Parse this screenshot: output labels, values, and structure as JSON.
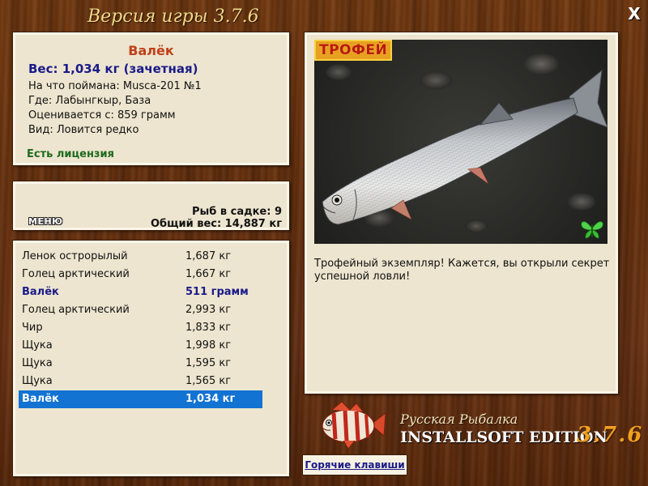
{
  "window": {
    "version_title": "Версия игры 3.7.6",
    "close_label": "X"
  },
  "fish_info": {
    "name": "Валёк",
    "weight": "Вес: 1,034 кг (зачетная)",
    "lines": [
      "На что поймана: Musca-201 №1",
      "Где: Лабынгкыр, База",
      "Оценивается с: 859 грамм",
      "Вид: Ловится редко"
    ],
    "license": "Есть лицензия"
  },
  "keepnet": {
    "menu_label": "МЕНЮ",
    "fish_count": "Рыб в садке: 9",
    "total_weight": "Общий вес: 14,887 кг"
  },
  "catch_list": [
    {
      "name": "Ленок острорылый",
      "weight": "1,687 кг",
      "style": "normal"
    },
    {
      "name": "Голец арктический",
      "weight": "1,667 кг",
      "style": "normal"
    },
    {
      "name": "Валёк",
      "weight": "511 грамм",
      "style": "trophy"
    },
    {
      "name": "Голец арктический",
      "weight": "2,993 кг",
      "style": "normal"
    },
    {
      "name": "Чир",
      "weight": "1,833 кг",
      "style": "normal"
    },
    {
      "name": "Щука",
      "weight": "1,998 кг",
      "style": "normal"
    },
    {
      "name": "Щука",
      "weight": "1,595 кг",
      "style": "normal"
    },
    {
      "name": "Щука",
      "weight": "1,565 кг",
      "style": "normal"
    },
    {
      "name": "Валёк",
      "weight": "1,034 кг",
      "style": "selected"
    }
  ],
  "photo": {
    "trophy_label": "ТРОФЕЙ",
    "butterfly_icon": "butterfly-icon",
    "description": "Трофейный экземпляр! Кажется, вы открыли секрет успешной ловли!"
  },
  "logo": {
    "subtitle": "Русская Рыбалка",
    "edition": "INSTALLSOFT EDITION",
    "version": "3.7.6"
  },
  "hotkeys_label": "Горячие клавиши",
  "colors": {
    "selected_row": "#1273d3",
    "trophy_text": "#1a1a8a",
    "fish_name": "#c0401a",
    "license": "#1e6a1e"
  }
}
